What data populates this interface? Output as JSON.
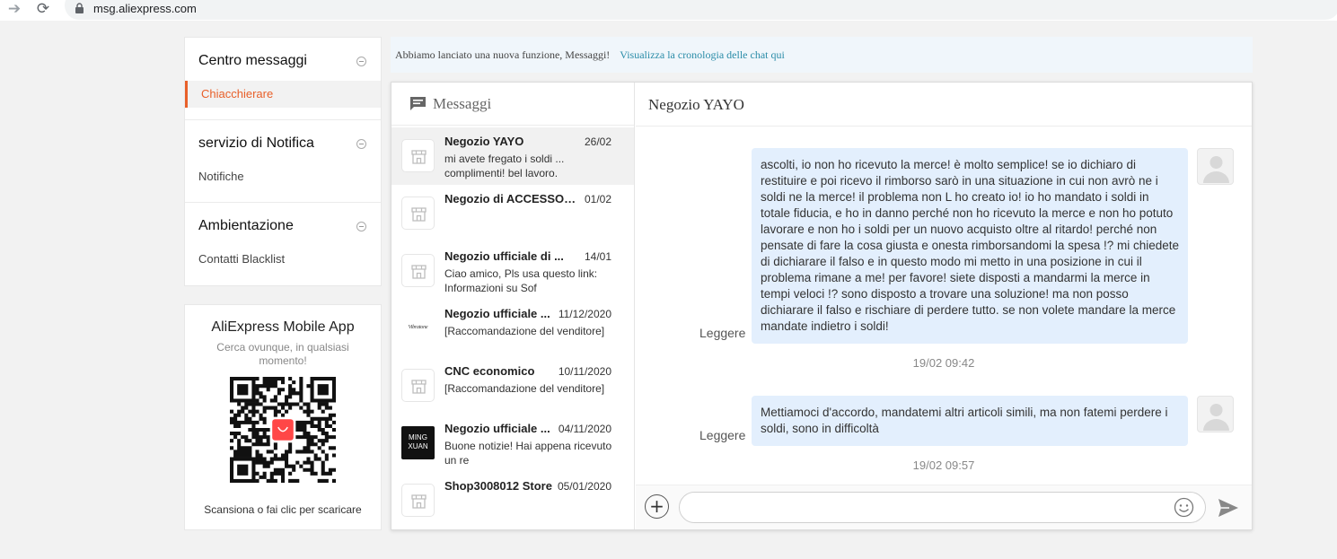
{
  "browser": {
    "url": "msg.aliexpress.com",
    "back_glyph": "🡒",
    "reload_glyph": "⟳",
    "icons": [
      "arrow-forward-icon",
      "reload-icon",
      "lock-icon"
    ]
  },
  "sidebar": {
    "sections": [
      {
        "title": "Centro messaggi",
        "item": "Chiacchierare",
        "active": true
      },
      {
        "title": "servizio di Notifica",
        "item": "Notifiche",
        "active": false
      },
      {
        "title": "Ambientazione",
        "item": "Contatti Blacklist",
        "active": false
      }
    ]
  },
  "app_promo": {
    "title": "AliExpress Mobile App",
    "subtitle": "Cerca ovunque, in qualsiasi momento!",
    "caption": "Scansiona o fai clic per scaricare",
    "qr_logo_color": "#ff4747"
  },
  "banner": {
    "text": "Abbiamo lanciato una nuova funzione, Messaggi!",
    "link": "Visualizza la cronologia delle chat qui"
  },
  "messages_header": "Messaggi",
  "conversations": [
    {
      "name": "Negozio YAYO",
      "date": "26/02",
      "preview": "mi avete fregato i soldi ... complimenti! bel lavoro.",
      "avatar": "store",
      "selected": true
    },
    {
      "name": "Negozio di ACCESSORIES",
      "date": "01/02",
      "preview": "",
      "avatar": "store",
      "selected": false
    },
    {
      "name": "Negozio ufficiale di ...",
      "date": "14/01",
      "preview": "Ciao amico, Pls usa questo link: Informazioni su Sof",
      "avatar": "store",
      "selected": false
    },
    {
      "name": "Negozio ufficiale ...",
      "date": "11/12/2020",
      "preview": "[Raccomandazione del venditore]",
      "avatar": "logo-text",
      "avatar_text": "Vibratone",
      "selected": false
    },
    {
      "name": "CNC economico",
      "date": "10/11/2020",
      "preview": "[Raccomandazione del venditore]",
      "avatar": "store",
      "selected": false
    },
    {
      "name": "Negozio ufficiale ...",
      "date": "04/11/2020",
      "preview": "Buone notizie! Hai appena ricevuto un re",
      "avatar": "logo-mx",
      "avatar_text": "MING XUAN",
      "selected": false
    },
    {
      "name": "Shop3008012 Store",
      "date": "05/01/2020",
      "preview": "",
      "avatar": "store",
      "selected": false
    }
  ],
  "chat": {
    "title": "Negozio YAYO",
    "read_label": "Leggere",
    "bubble_color": "#e3effd",
    "messages": [
      {
        "text": "ascolti, io non ho ricevuto la merce! è molto semplice! se io dichiaro di restituire e poi ricevo il rimborso sarò in una situazione in cui non avrò ne i soldi ne la merce! il problema non L ho creato io! io ho mandato i soldi in totale fiducia, e ho in danno perché non ho ricevuto la merce e non ho potuto lavorare e non ho i soldi per un nuovo acquisto oltre al ritardo! perché non pensate di fare la cosa giusta e onesta rimborsandomi la spesa !? mi chiedete di dichiarare il falso e in questo modo mi metto in una posizione in cui il problema rimane a me! per favore! siete disposti a mandarmi la merce in tempi veloci !? sono disposto a trovare una soluzione! ma non posso dichiarare il falso e rischiare di perdere tutto. se non volete mandare la merce mandate indietro i soldi!",
        "time": "19/02 09:42"
      },
      {
        "text": "Mettiamoci d'accordo, mandatemi altri articoli simili, ma non fatemi perdere i soldi, sono in difficoltà",
        "time": "19/02 09:57"
      }
    ],
    "input_placeholder": "",
    "add_glyph": "+"
  },
  "accent_color": "#e8602a",
  "link_color": "#2a8ca8"
}
